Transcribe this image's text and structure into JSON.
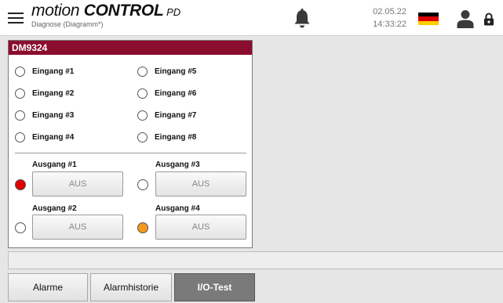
{
  "header": {
    "brand_part1": "motion ",
    "brand_part2": "CONTROL",
    "brand_part3": " PD",
    "subtitle": "Diagnose (Diagramm*)",
    "date": "02.05.22",
    "time": "14:33:22",
    "icons": [
      "menu-icon",
      "bell-icon",
      "flag-de-icon",
      "user-icon",
      "lock-icon"
    ]
  },
  "panel": {
    "title": "DM9324",
    "inputs": [
      "Eingang #1",
      "Eingang #2",
      "Eingang #3",
      "Eingang #4",
      "Eingang #5",
      "Eingang #6",
      "Eingang #7",
      "Eingang #8"
    ],
    "outputs": [
      {
        "label": "Ausgang #1",
        "button": "AUS",
        "led_color": "#e00000"
      },
      {
        "label": "Ausgang #2",
        "button": "AUS",
        "led_color": "#ffffff"
      },
      {
        "label": "Ausgang #3",
        "button": "AUS",
        "led_color": "#ffffff"
      },
      {
        "label": "Ausgang #4",
        "button": "AUS",
        "led_color": "#f39a1e"
      }
    ]
  },
  "tabs": [
    {
      "label": "Alarme",
      "active": false
    },
    {
      "label": "Alarmhistorie",
      "active": false
    },
    {
      "label": "I/O-Test",
      "active": true
    }
  ],
  "colors": {
    "title_bar": "#8b0d2e",
    "active_tab": "#7a7a7a"
  }
}
